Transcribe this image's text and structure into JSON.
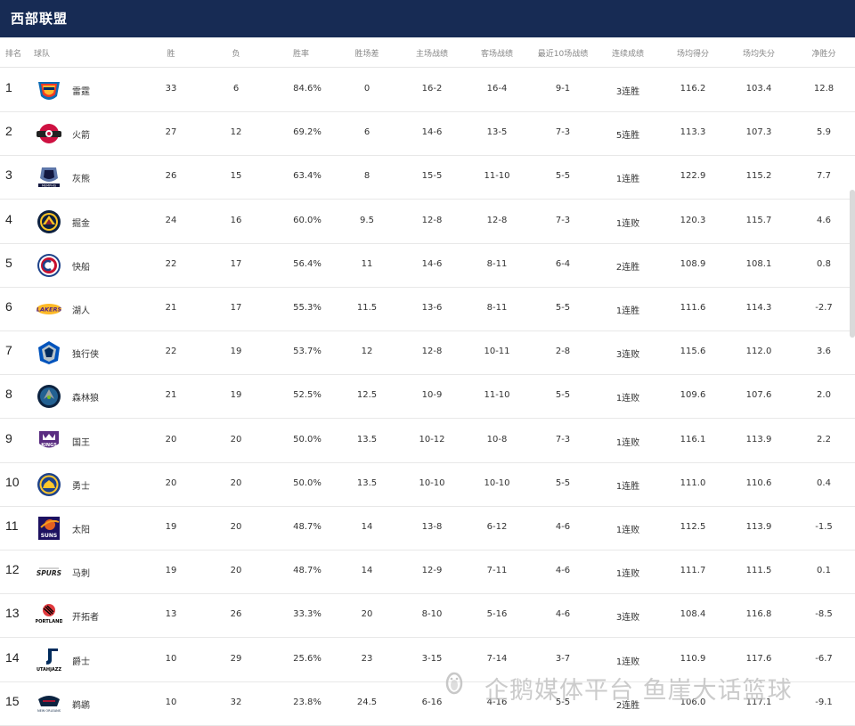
{
  "header": {
    "title": "西部联盟"
  },
  "columns": {
    "rank": "排名",
    "team": "球队",
    "wins": "胜",
    "losses": "负",
    "pct": "胜率",
    "gb": "胜场差",
    "home": "主场战绩",
    "away": "客场战绩",
    "last10": "最近10场战绩",
    "streak": "连续成绩",
    "ppg": "场均得分",
    "oppg": "场均失分",
    "diff": "净胜分"
  },
  "teams": [
    {
      "rank": "1",
      "name": "雷霆",
      "logo": "thunder-logo",
      "wins": "33",
      "losses": "6",
      "pct": "84.6%",
      "gb": "0",
      "home": "16-2",
      "away": "16-4",
      "last10": "9-1",
      "streak": "3连胜",
      "ppg": "116.2",
      "oppg": "103.4",
      "diff": "12.8"
    },
    {
      "rank": "2",
      "name": "火箭",
      "logo": "rockets-logo",
      "wins": "27",
      "losses": "12",
      "pct": "69.2%",
      "gb": "6",
      "home": "14-6",
      "away": "13-5",
      "last10": "7-3",
      "streak": "5连胜",
      "ppg": "113.3",
      "oppg": "107.3",
      "diff": "5.9"
    },
    {
      "rank": "3",
      "name": "灰熊",
      "logo": "grizzlies-logo",
      "wins": "26",
      "losses": "15",
      "pct": "63.4%",
      "gb": "8",
      "home": "15-5",
      "away": "11-10",
      "last10": "5-5",
      "streak": "1连胜",
      "ppg": "122.9",
      "oppg": "115.2",
      "diff": "7.7"
    },
    {
      "rank": "4",
      "name": "掘金",
      "logo": "nuggets-logo",
      "wins": "24",
      "losses": "16",
      "pct": "60.0%",
      "gb": "9.5",
      "home": "12-8",
      "away": "12-8",
      "last10": "7-3",
      "streak": "1连败",
      "ppg": "120.3",
      "oppg": "115.7",
      "diff": "4.6"
    },
    {
      "rank": "5",
      "name": "快船",
      "logo": "clippers-logo",
      "wins": "22",
      "losses": "17",
      "pct": "56.4%",
      "gb": "11",
      "home": "14-6",
      "away": "8-11",
      "last10": "6-4",
      "streak": "2连胜",
      "ppg": "108.9",
      "oppg": "108.1",
      "diff": "0.8"
    },
    {
      "rank": "6",
      "name": "湖人",
      "logo": "lakers-logo",
      "wins": "21",
      "losses": "17",
      "pct": "55.3%",
      "gb": "11.5",
      "home": "13-6",
      "away": "8-11",
      "last10": "5-5",
      "streak": "1连胜",
      "ppg": "111.6",
      "oppg": "114.3",
      "diff": "-2.7"
    },
    {
      "rank": "7",
      "name": "独行侠",
      "logo": "mavericks-logo",
      "wins": "22",
      "losses": "19",
      "pct": "53.7%",
      "gb": "12",
      "home": "12-8",
      "away": "10-11",
      "last10": "2-8",
      "streak": "3连败",
      "ppg": "115.6",
      "oppg": "112.0",
      "diff": "3.6"
    },
    {
      "rank": "8",
      "name": "森林狼",
      "logo": "timberwolves-logo",
      "wins": "21",
      "losses": "19",
      "pct": "52.5%",
      "gb": "12.5",
      "home": "10-9",
      "away": "11-10",
      "last10": "5-5",
      "streak": "1连败",
      "ppg": "109.6",
      "oppg": "107.6",
      "diff": "2.0"
    },
    {
      "rank": "9",
      "name": "国王",
      "logo": "kings-logo",
      "wins": "20",
      "losses": "20",
      "pct": "50.0%",
      "gb": "13.5",
      "home": "10-12",
      "away": "10-8",
      "last10": "7-3",
      "streak": "1连败",
      "ppg": "116.1",
      "oppg": "113.9",
      "diff": "2.2"
    },
    {
      "rank": "10",
      "name": "勇士",
      "logo": "warriors-logo",
      "wins": "20",
      "losses": "20",
      "pct": "50.0%",
      "gb": "13.5",
      "home": "10-10",
      "away": "10-10",
      "last10": "5-5",
      "streak": "1连胜",
      "ppg": "111.0",
      "oppg": "110.6",
      "diff": "0.4"
    },
    {
      "rank": "11",
      "name": "太阳",
      "logo": "suns-logo",
      "wins": "19",
      "losses": "20",
      "pct": "48.7%",
      "gb": "14",
      "home": "13-8",
      "away": "6-12",
      "last10": "4-6",
      "streak": "1连败",
      "ppg": "112.5",
      "oppg": "113.9",
      "diff": "-1.5"
    },
    {
      "rank": "12",
      "name": "马刺",
      "logo": "spurs-logo",
      "wins": "19",
      "losses": "20",
      "pct": "48.7%",
      "gb": "14",
      "home": "12-9",
      "away": "7-11",
      "last10": "4-6",
      "streak": "1连败",
      "ppg": "111.7",
      "oppg": "111.5",
      "diff": "0.1"
    },
    {
      "rank": "13",
      "name": "开拓者",
      "logo": "blazers-logo",
      "wins": "13",
      "losses": "26",
      "pct": "33.3%",
      "gb": "20",
      "home": "8-10",
      "away": "5-16",
      "last10": "4-6",
      "streak": "3连败",
      "ppg": "108.4",
      "oppg": "116.8",
      "diff": "-8.5"
    },
    {
      "rank": "14",
      "name": "爵士",
      "logo": "jazz-logo",
      "wins": "10",
      "losses": "29",
      "pct": "25.6%",
      "gb": "23",
      "home": "3-15",
      "away": "7-14",
      "last10": "3-7",
      "streak": "1连败",
      "ppg": "110.9",
      "oppg": "117.6",
      "diff": "-6.7"
    },
    {
      "rank": "15",
      "name": "鹈鹕",
      "logo": "pelicans-logo",
      "wins": "10",
      "losses": "32",
      "pct": "23.8%",
      "gb": "24.5",
      "home": "6-16",
      "away": "4-16",
      "last10": "5-5",
      "streak": "2连胜",
      "ppg": "106.0",
      "oppg": "117.1",
      "diff": "-9.1"
    }
  ],
  "logo_text": {
    "spurs": "SPURS",
    "blazers": "PORTLAND",
    "jazz": "UTAHJAZZ",
    "pelicans": "NEW ORLEANS",
    "suns": "SUNS",
    "grizzlies": "MEMPHIS",
    "lakers": "LAKERS",
    "kings": "KINGS"
  },
  "watermark": {
    "text": "企鹅媒体平台 鱼崖大话篮球"
  },
  "colors": {
    "header_bg": "#172b54",
    "header_text": "#ffffff",
    "row_border": "#e8e8e8"
  }
}
